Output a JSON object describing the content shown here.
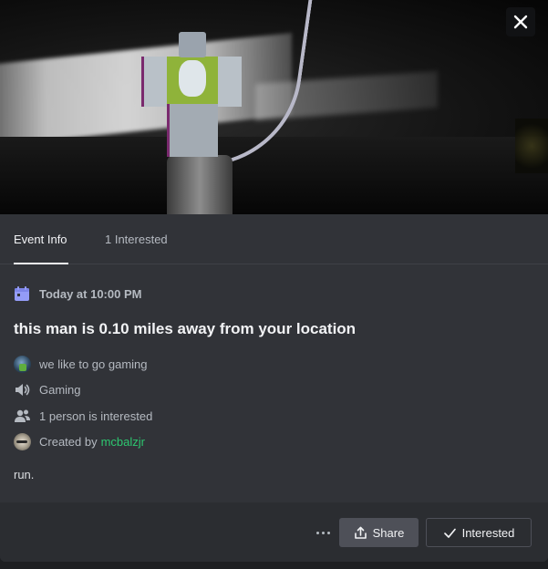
{
  "tabs": {
    "event_info": "Event Info",
    "interested": "1 Interested"
  },
  "event": {
    "date": "Today at 10:00 PM",
    "title": "this man is 0.10 miles away from your location",
    "server": "we like to go gaming",
    "channel": "Gaming",
    "interested_count": "1 person is interested",
    "created_by_prefix": "Created by",
    "creator": "mcbalzjr",
    "description": "run."
  },
  "actions": {
    "share": "Share",
    "interested": "Interested"
  },
  "colors": {
    "creator": "#2dc770",
    "calendar_icon": "#949cf7"
  },
  "icons": {
    "close": "close-icon",
    "calendar": "calendar-icon",
    "speaker": "speaker-icon",
    "people": "people-icon",
    "more": "more-icon",
    "share": "share-icon",
    "check": "check-icon"
  }
}
